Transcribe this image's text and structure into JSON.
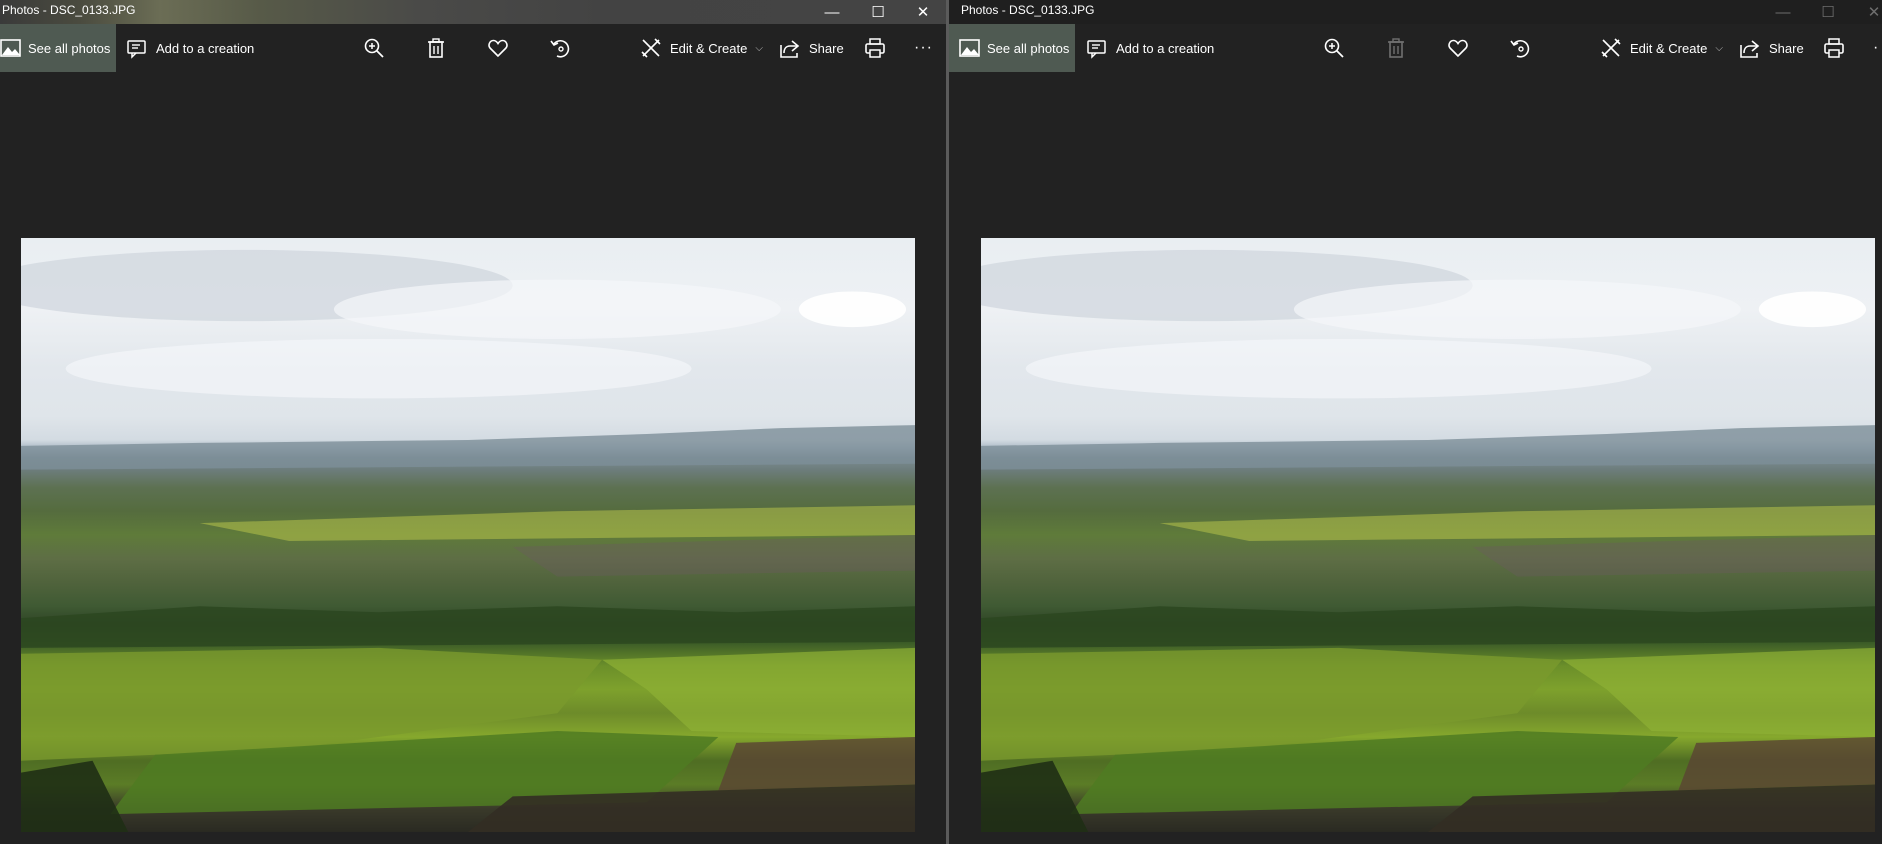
{
  "windows": [
    {
      "title": "Photos - DSC_0133.JPG",
      "controls": {
        "minimize": "—",
        "maximize": "☐",
        "close": "✕"
      },
      "toolbar": {
        "see_all_photos": "See all photos",
        "add_to_creation": "Add to a creation",
        "edit_create": "Edit & Create",
        "share": "Share",
        "more": "···"
      }
    },
    {
      "title": "Photos - DSC_0133.JPG",
      "controls": {
        "minimize": "—",
        "maximize": "☐",
        "close": "✕"
      },
      "toolbar": {
        "see_all_photos": "See all photos",
        "add_to_creation": "Add to a creation",
        "edit_create": "Edit & Create",
        "share": "Share",
        "more": "·"
      }
    }
  ],
  "icons": [
    "photos-icon",
    "add-to-creation-icon",
    "zoom-in-icon",
    "delete-icon",
    "favorite-heart-icon",
    "rotate-icon",
    "edit-create-icon",
    "share-icon",
    "print-icon",
    "more-icon"
  ],
  "colors": {
    "active_button": "#4f5a52",
    "background": "#222222",
    "text": "#ffffff",
    "disabled_icon": "#6e6e6e"
  }
}
